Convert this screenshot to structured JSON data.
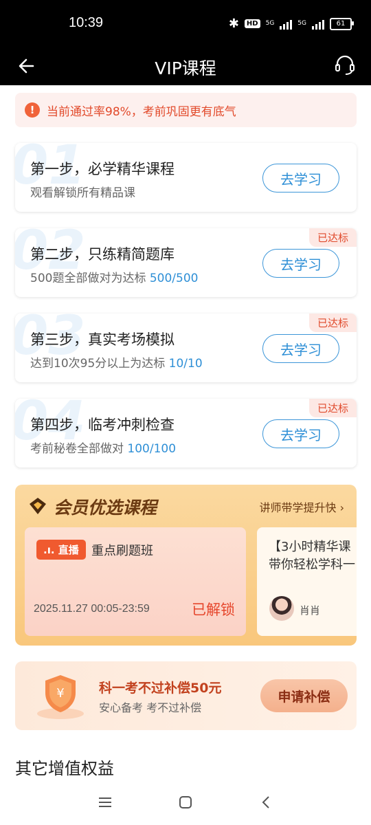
{
  "status_bar": {
    "time": "10:39",
    "battery": "61",
    "network_labels": [
      "5G",
      "5G"
    ],
    "hd": "HD"
  },
  "app_bar": {
    "title": "VIP课程",
    "back_icon": "arrow-left-icon",
    "service_icon": "headset-icon"
  },
  "notice": {
    "icon": "exclamation-icon",
    "text": "当前通过率98%，考前巩固更有底气"
  },
  "steps": [
    {
      "number": "01",
      "title": "第一步，必学精华课程",
      "desc": "观看解锁所有精品课",
      "progress": "",
      "button": "去学习",
      "badge": ""
    },
    {
      "number": "02",
      "title": "第二步，只练精简题库",
      "desc": "500题全部做对为达标 ",
      "progress": "500/500",
      "button": "去学习",
      "badge": "已达标"
    },
    {
      "number": "03",
      "title": "第三步，真实考场模拟",
      "desc": "达到10次95分以上为达标 ",
      "progress": "10/10",
      "button": "去学习",
      "badge": "已达标"
    },
    {
      "number": "04",
      "title": "第四步，临考冲刺检查",
      "desc": "考前秘卷全部做对 ",
      "progress": "100/100",
      "button": "去学习",
      "badge": "已达标"
    }
  ],
  "member": {
    "title": "会员优选课程",
    "link": "讲师带学提升快 ›",
    "course1": {
      "badge": ".ı. 直播",
      "name": "重点刷题班",
      "date": "2025.11.27 00:05-23:59",
      "status": "已解锁"
    },
    "course2": {
      "title": "【3小时精华课\n带你轻松学科一",
      "teacher": "肖肖"
    }
  },
  "compensation": {
    "title": "科一考不过补偿50元",
    "subtitle": "安心备考 考不过补偿",
    "button": "申请补偿"
  },
  "other": {
    "title": "其它增值权益"
  },
  "colors": {
    "accent_blue": "#2e8fd6",
    "alert_red": "#e24a2b",
    "gold": "#f9c77c"
  }
}
